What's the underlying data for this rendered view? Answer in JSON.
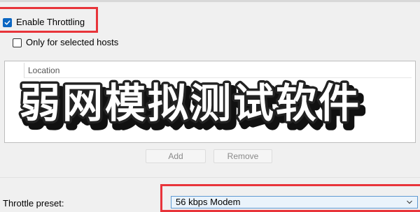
{
  "header": {
    "partial_text": ""
  },
  "options": {
    "enable_throttling": {
      "label": "Enable Throttling",
      "checked": true
    },
    "only_selected_hosts": {
      "label": "Only for selected hosts",
      "checked": false
    }
  },
  "hosts_table": {
    "column_location": "Location",
    "rows": []
  },
  "buttons": {
    "add": "Add",
    "remove": "Remove"
  },
  "preset": {
    "label": "Throttle preset:",
    "value": "56 kbps Modem"
  },
  "overlay_title": "弱网模拟测试软件",
  "colors": {
    "highlight_red": "#e8343a",
    "checkbox_blue": "#0c67c2",
    "select_bg": "#eaf3fb"
  }
}
